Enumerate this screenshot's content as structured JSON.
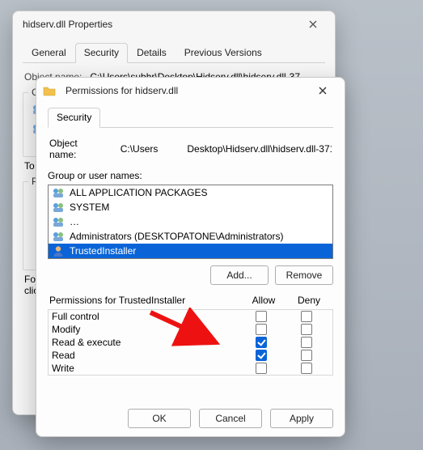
{
  "back": {
    "title": "hidserv.dll Properties",
    "tabs": [
      "General",
      "Security",
      "Details",
      "Previous Versions"
    ],
    "active_tab": 1,
    "object_name_label": "Object name:",
    "object_name_value": "C:\\Users\\subhr\\Desktop\\Hidserv.dll\\hidserv.dll-37…",
    "group_label_short": "Gro",
    "to_label": "To",
    "per_label": "Per",
    "for_label_1": "For",
    "for_label_2": "clic"
  },
  "front": {
    "title": "Permissions for hidserv.dll",
    "tab": "Security",
    "object_name_label": "Object name:",
    "object_name_value_left": "C:\\Users",
    "object_name_value_right": "Desktop\\Hidserv.dll\\hidserv.dll-371",
    "group_label": "Group or user names:",
    "principals": [
      {
        "icon": "group",
        "label": "ALL APPLICATION PACKAGES"
      },
      {
        "icon": "group",
        "label": "SYSTEM"
      },
      {
        "icon": "group",
        "label": "…"
      },
      {
        "icon": "group",
        "label": "Administrators (DESKTOPATONE\\Administrators)"
      },
      {
        "icon": "person",
        "label": "TrustedInstaller"
      }
    ],
    "selected_index": 4,
    "add_label": "Add...",
    "remove_label": "Remove",
    "perm_caption": "Permissions for TrustedInstaller",
    "col_allow": "Allow",
    "col_deny": "Deny",
    "permissions": [
      {
        "name": "Full control",
        "allow": false,
        "deny": false
      },
      {
        "name": "Modify",
        "allow": false,
        "deny": false
      },
      {
        "name": "Read & execute",
        "allow": true,
        "deny": false
      },
      {
        "name": "Read",
        "allow": true,
        "deny": false
      },
      {
        "name": "Write",
        "allow": false,
        "deny": false
      }
    ],
    "ok_label": "OK",
    "cancel_label": "Cancel",
    "apply_label": "Apply"
  }
}
